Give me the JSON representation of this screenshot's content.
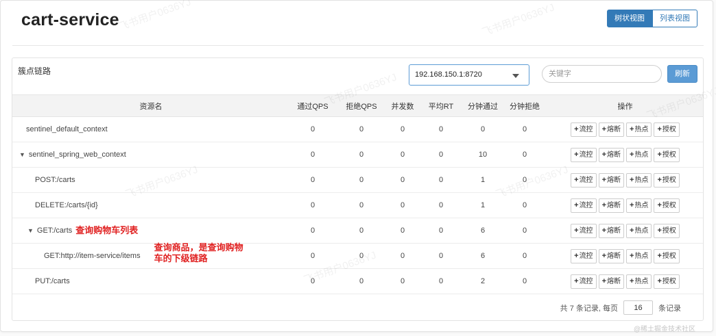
{
  "header": {
    "title": "cart-service",
    "view_tree": "树状视图",
    "view_list": "列表视图"
  },
  "panel": {
    "title": "簇点链路",
    "machine": "192.168.150.1:8720",
    "keyword_placeholder": "关键字",
    "refresh": "刷新"
  },
  "table": {
    "columns": [
      "资源名",
      "通过QPS",
      "拒绝QPS",
      "并发数",
      "平均RT",
      "分钟通过",
      "分钟拒绝",
      "操作"
    ],
    "ops": [
      "流控",
      "熔断",
      "热点",
      "授权"
    ],
    "rows": [
      {
        "name": "sentinel_default_context",
        "pass_qps": "0",
        "block_qps": "0",
        "concurrency": "0",
        "avg_rt": "0",
        "minute_pass": "0",
        "minute_block": "0"
      },
      {
        "name": "sentinel_spring_web_context",
        "pass_qps": "0",
        "block_qps": "0",
        "concurrency": "0",
        "avg_rt": "0",
        "minute_pass": "10",
        "minute_block": "0"
      },
      {
        "name": "POST:/carts",
        "pass_qps": "0",
        "block_qps": "0",
        "concurrency": "0",
        "avg_rt": "0",
        "minute_pass": "1",
        "minute_block": "0"
      },
      {
        "name": "DELETE:/carts/{id}",
        "pass_qps": "0",
        "block_qps": "0",
        "concurrency": "0",
        "avg_rt": "0",
        "minute_pass": "1",
        "minute_block": "0"
      },
      {
        "name": "GET:/carts",
        "pass_qps": "0",
        "block_qps": "0",
        "concurrency": "0",
        "avg_rt": "0",
        "minute_pass": "6",
        "minute_block": "0"
      },
      {
        "name": "GET:http://item-service/items",
        "pass_qps": "0",
        "block_qps": "0",
        "concurrency": "0",
        "avg_rt": "0",
        "minute_pass": "6",
        "minute_block": "0"
      },
      {
        "name": "PUT:/carts",
        "pass_qps": "0",
        "block_qps": "0",
        "concurrency": "0",
        "avg_rt": "0",
        "minute_pass": "2",
        "minute_block": "0"
      }
    ]
  },
  "annotations": {
    "get_carts": "查询购物车列表",
    "item_service_line1": "查询商品，是查询购物",
    "item_service_line2": "车的下级链路"
  },
  "footer": {
    "prefix": "共 7 条记录, 每页",
    "page_size": "16",
    "suffix": "条记录"
  },
  "watermark": "飞书用户0636YJ",
  "credit": "@稀土掘金技术社区"
}
